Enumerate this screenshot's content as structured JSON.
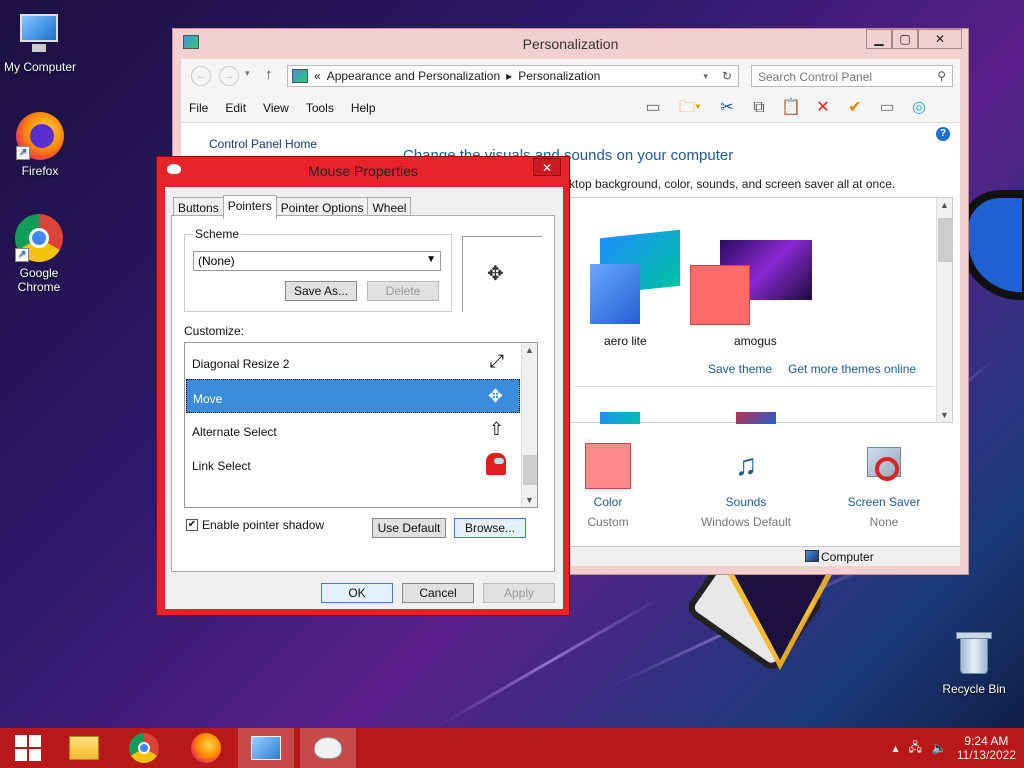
{
  "desktop": {
    "icons": [
      {
        "label": "My Computer"
      },
      {
        "label": "Firefox"
      },
      {
        "label": "Google Chrome"
      },
      {
        "label": "Recycle Bin"
      }
    ]
  },
  "personalization": {
    "title": "Personalization",
    "address": {
      "prefix": "«",
      "crumb1": "Appearance and Personalization",
      "crumb2": "Personalization"
    },
    "search_placeholder": "Search Control Panel",
    "menu": [
      "File",
      "Edit",
      "View",
      "Tools",
      "Help"
    ],
    "sidebar_link": "Control Panel Home",
    "heading": "Change the visuals and sounds on your computer",
    "subheading": "ktop background, color, sounds, and screen saver all at once.",
    "themes": [
      {
        "name": "aero lite"
      },
      {
        "name": "amogus"
      }
    ],
    "save_theme": "Save theme",
    "more_themes": "Get more themes online",
    "bottom": [
      {
        "label": "Color",
        "value": "Custom"
      },
      {
        "label": "Sounds",
        "value": "Windows Default"
      },
      {
        "label": "Screen Saver",
        "value": "None"
      }
    ],
    "status": "Computer"
  },
  "mouse_dialog": {
    "title": "Mouse Properties",
    "tabs": [
      "Buttons",
      "Pointers",
      "Pointer Options",
      "Wheel"
    ],
    "active_tab": "Pointers",
    "scheme_label": "Scheme",
    "scheme_value": "(None)",
    "save_as": "Save As...",
    "delete": "Delete",
    "customize_label": "Customize:",
    "pointers": [
      {
        "name": "Diagonal Resize 2",
        "cursor": "⤢"
      },
      {
        "name": "Move",
        "cursor": "✥"
      },
      {
        "name": "Alternate Select",
        "cursor": "⇧"
      },
      {
        "name": "Link Select",
        "cursor": ""
      }
    ],
    "selected_pointer": "Move",
    "shadow_label": "Enable pointer shadow",
    "shadow_checked": true,
    "use_default": "Use Default",
    "browse": "Browse...",
    "ok": "OK",
    "cancel": "Cancel",
    "apply": "Apply"
  },
  "taskbar": {
    "time": "9:24 AM",
    "date": "11/13/2022"
  }
}
